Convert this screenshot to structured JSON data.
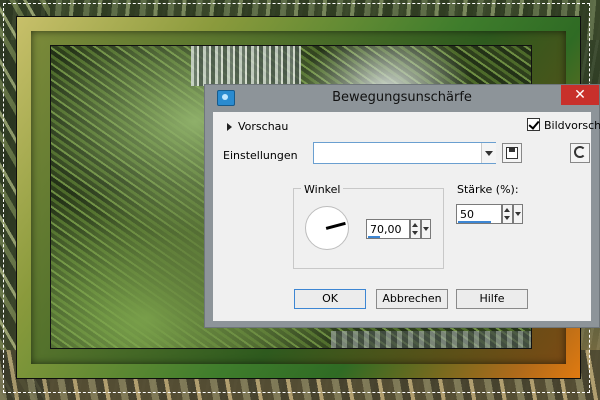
{
  "dialog": {
    "title": "Bewegungsunschärfe",
    "close_glyph": "✕",
    "app_icon": "psp-app-icon",
    "preview_label": "Vorschau",
    "image_preview_label": "Bildvorschau",
    "image_preview_checked": true,
    "settings_label": "Einstellungen",
    "settings_value": "",
    "angle": {
      "group_label": "Winkel",
      "value": "70,00"
    },
    "strength": {
      "label": "Stärke (%):",
      "value": "50"
    },
    "buttons": {
      "ok": "OK",
      "cancel": "Abbrechen",
      "help": "Hilfe"
    }
  },
  "colors": {
    "dialog_frame": "#8d9499",
    "close_button": "#c8302b",
    "accent": "#3d86d3"
  }
}
